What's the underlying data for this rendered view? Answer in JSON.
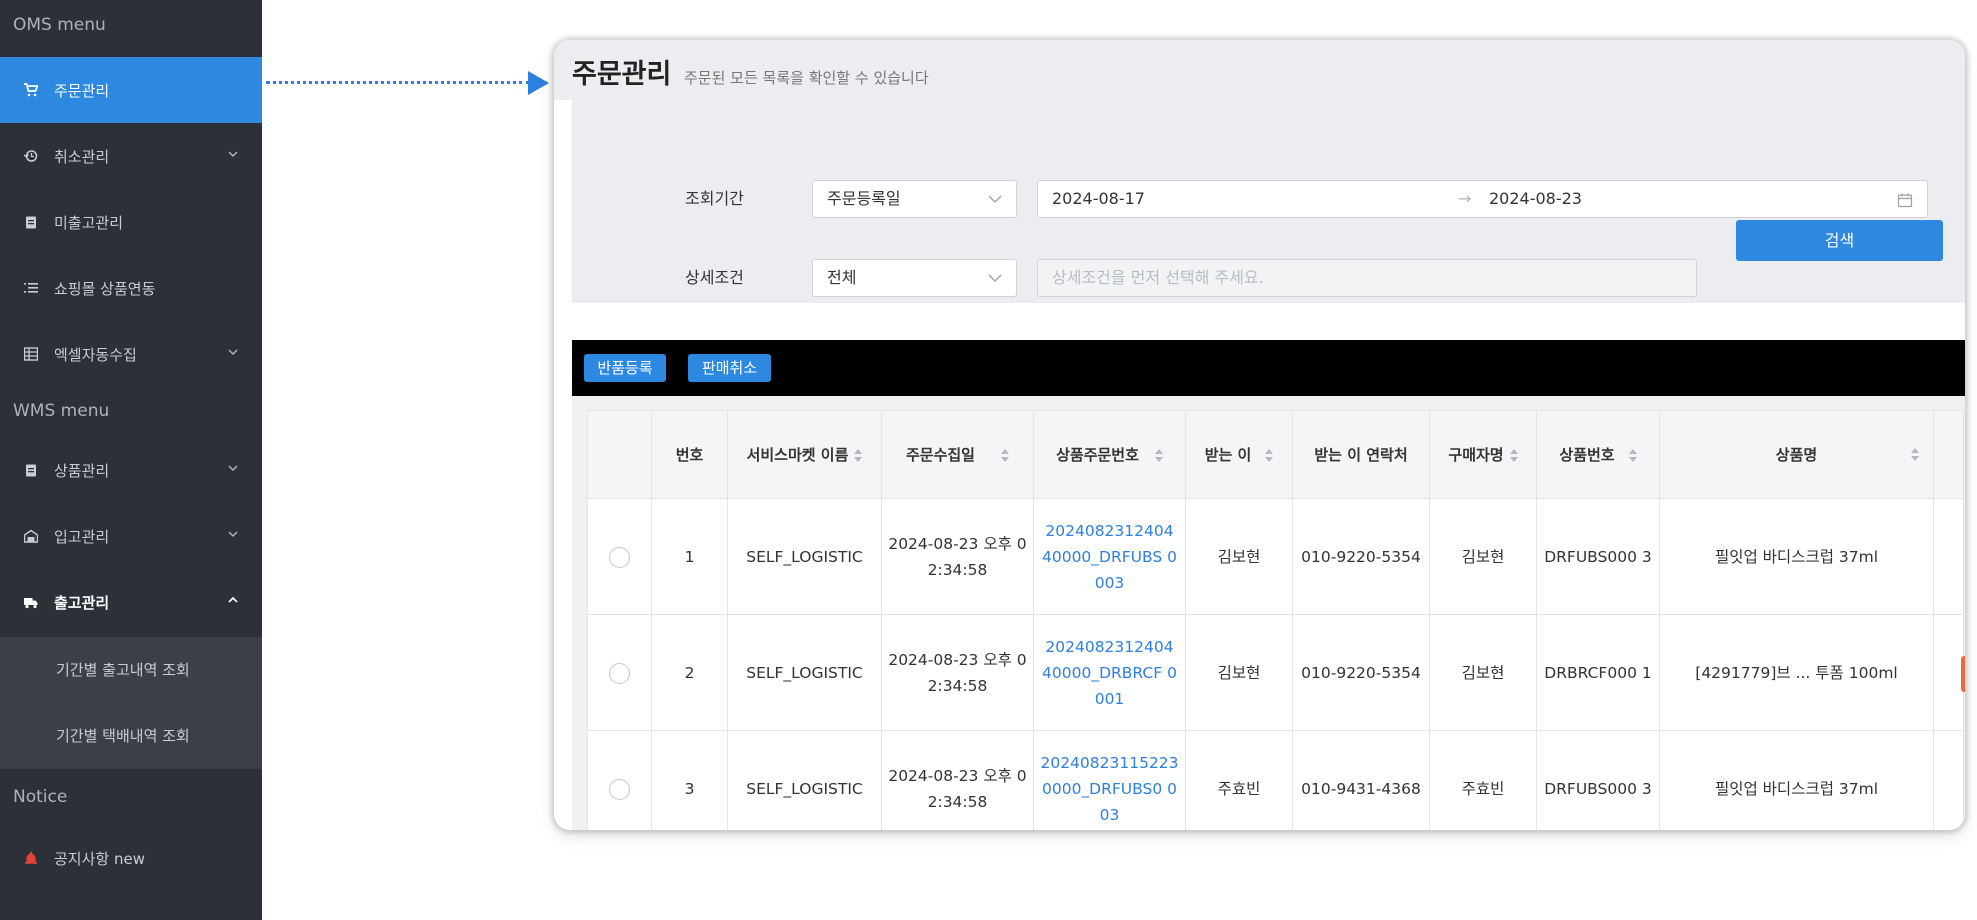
{
  "sidebar": {
    "oms_header": "OMS menu",
    "wms_header": "WMS menu",
    "notice_header": "Notice",
    "items": [
      {
        "label": "주문관리",
        "icon": "cart-icon"
      },
      {
        "label": "취소관리",
        "icon": "history-icon"
      },
      {
        "label": "미출고관리",
        "icon": "clipboard-icon"
      },
      {
        "label": "쇼핑몰 상품연동",
        "icon": "list-icon"
      },
      {
        "label": "엑셀자동수집",
        "icon": "excel-icon"
      },
      {
        "label": "상품관리",
        "icon": "clipboard-icon"
      },
      {
        "label": "입고관리",
        "icon": "warehouse-icon"
      },
      {
        "label": "출고관리",
        "icon": "truck-icon"
      },
      {
        "label": "공지사항 new",
        "icon": "bell-icon"
      }
    ],
    "subitems": [
      "기간별 출고내역 조회",
      "기간별 택배내역 조회"
    ]
  },
  "page": {
    "title": "주문관리",
    "subtitle": "주문된 모든 목록을 확인할 수 있습니다"
  },
  "search": {
    "period_label": "조회기간",
    "period_type": "주문등록일",
    "date_from": "2024-08-17",
    "date_to": "2024-08-23",
    "date_sep": "→",
    "detail_label": "상세조건",
    "detail_type": "전체",
    "detail_placeholder": "상세조건을 먼저 선택해 주세요.",
    "search_button": "검색"
  },
  "actions": {
    "return_button": "반품등록",
    "cancel_button": "판매취소"
  },
  "table": {
    "headers": [
      "",
      "번호",
      "서비스마켓 이름",
      "주문수집일",
      "상품주문번호",
      "받는 이",
      "받는 이 연락처",
      "구매자명",
      "상품번호",
      "상품명"
    ],
    "rows": [
      {
        "no": "1",
        "market": "SELF_LOGISTIC",
        "date": "2024-08-23 오후 02:34:58",
        "order_no": "2024082312404 40000_DRFUBS 0003",
        "receiver": "김보현",
        "phone": "010-9220-5354",
        "buyer": "김보현",
        "product_no": "DRFUBS000 3",
        "product_name": "필잇업 바디스크럽 37ml"
      },
      {
        "no": "2",
        "market": "SELF_LOGISTIC",
        "date": "2024-08-23 오후 02:34:58",
        "order_no": "2024082312404 40000_DRBRCF 0001",
        "receiver": "김보현",
        "phone": "010-9220-5354",
        "buyer": "김보현",
        "product_no": "DRBRCF000 1",
        "product_name": "[4291779]브 ... 투폼 100ml"
      },
      {
        "no": "3",
        "market": "SELF_LOGISTIC",
        "date": "2024-08-23 오후 02:34:58",
        "order_no": "20240823115223 0000_DRFUBS0 003",
        "receiver": "주효빈",
        "phone": "010-9431-4368",
        "buyer": "주효빈",
        "product_no": "DRFUBS000 3",
        "product_name": "필잇업 바디스크럽 37ml"
      }
    ]
  },
  "colors": {
    "accent": "#2d88e0",
    "sidebar_bg": "#2c3038",
    "link": "#2d7fe0"
  }
}
